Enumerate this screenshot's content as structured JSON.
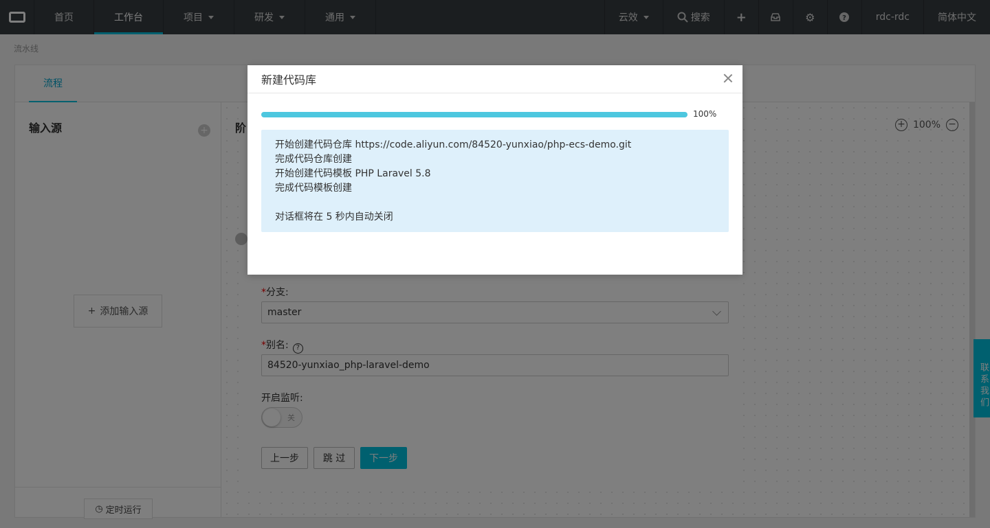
{
  "nav": {
    "items": [
      {
        "label": "首页"
      },
      {
        "label": "工作台"
      },
      {
        "label": "项目"
      },
      {
        "label": "研发"
      },
      {
        "label": "通用"
      }
    ],
    "right": {
      "workspace": "云效",
      "search": "搜索",
      "user": "rdc-rdc",
      "language": "简体中文"
    }
  },
  "breadcrumb": "流水线",
  "pipeline": {
    "tab": "流程",
    "source_title": "输入源",
    "add_source": "添加输入源",
    "timer_run": "定时运行",
    "stage_title": "阶",
    "zoom": "100%"
  },
  "form": {
    "branch_label": "分支:",
    "branch_value": "master",
    "alias_label": "别名:",
    "alias_value": "84520-yunxiao_php-laravel-demo",
    "listen_label": "开启监听:",
    "toggle_text": "关",
    "prev": "上一步",
    "skip": "跳 过",
    "next": "下一步"
  },
  "feedback": "联系我们",
  "modal": {
    "title": "新建代码库",
    "progress": 1.0,
    "progress_label": "100%",
    "log": [
      "开始创建代码仓库 https://code.aliyun.com/84520-yunxiao/php-ecs-demo.git",
      "完成代码仓库创建",
      "开始创建代码模板 PHP Laravel 5.8",
      "完成代码模板创建"
    ],
    "countdown": "对话框将在 5 秒内自动关闭"
  },
  "colors": {
    "accent": "#00c1de",
    "nav_bg": "#373d41",
    "progress": "#4dc7df",
    "log_bg": "#def0fb"
  }
}
